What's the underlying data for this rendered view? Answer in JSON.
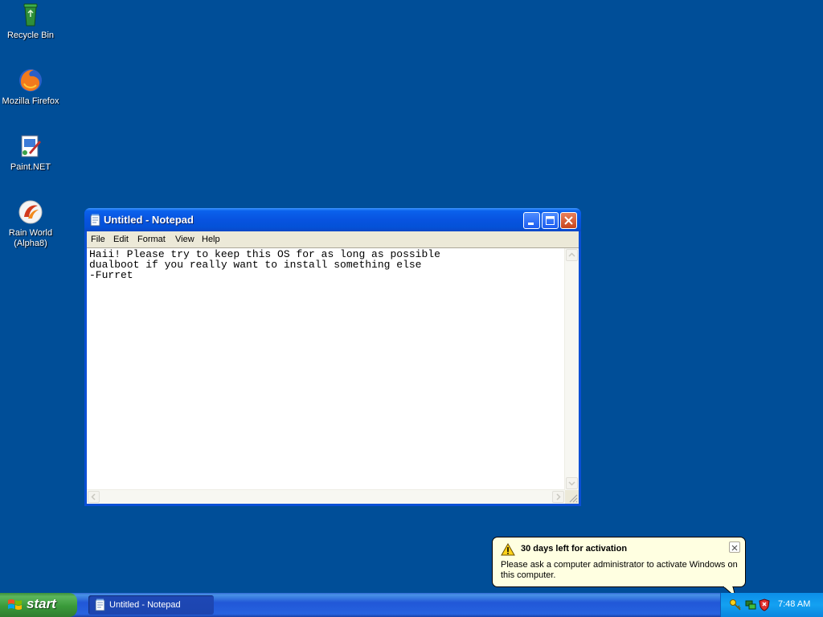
{
  "desktop": {
    "icons": [
      {
        "label": "Recycle Bin",
        "icon": "recycle-bin-icon"
      },
      {
        "label": "Mozilla Firefox",
        "icon": "firefox-icon"
      },
      {
        "label": "Paint.NET",
        "icon": "paint-net-icon"
      },
      {
        "label": "Rain World (Alpha8)",
        "icon": "rain-world-icon"
      }
    ]
  },
  "notepad": {
    "title": "Untitled - Notepad",
    "menu": [
      "File",
      "Edit",
      "Format",
      "View",
      "Help"
    ],
    "content": "Haii! Please try to keep this OS for as long as possible\ndualboot if you really want to install something else\n-Furret"
  },
  "balloon": {
    "title": "30 days left for activation",
    "body": "Please ask a computer administrator to activate Windows on this computer."
  },
  "taskbar": {
    "start_label": "start",
    "task_label": "Untitled - Notepad",
    "clock": "7:48 AM"
  },
  "colors": {
    "desktop": "#004e98",
    "titlebar": "#0853e0",
    "taskbar": "#2157d7",
    "start": "#3a9a3a",
    "balloon": "#ffffe1"
  }
}
